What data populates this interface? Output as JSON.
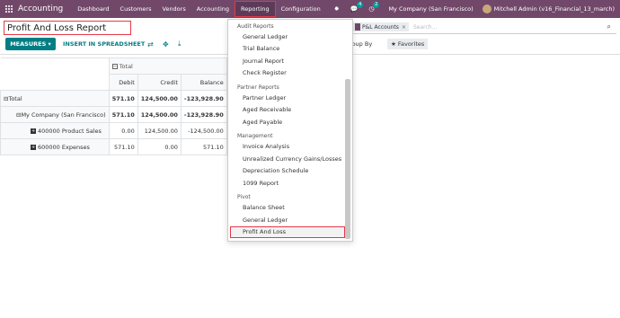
{
  "navbar": {
    "app_name": "Accounting",
    "menu": [
      "Dashboard",
      "Customers",
      "Vendors",
      "Accounting",
      "Reporting",
      "Configuration"
    ],
    "messages_badge": "4",
    "activity_badge": "2",
    "company": "My Company (San Francisco)",
    "user": "Mitchell Admin (v16_Financial_13_march)"
  },
  "control_panel": {
    "title": "Profit And Loss Report",
    "measures_label": "MEASURES",
    "insert_label": "INSERT IN SPREADSHEET",
    "search_facet": "P&L Accounts",
    "search_placeholder": "Search...",
    "group_by_label": "Group By",
    "favorites_label": "Favorites"
  },
  "pivot": {
    "col_group": "Total",
    "measures": [
      "Debit",
      "Credit",
      "Balance"
    ],
    "rows": [
      {
        "label": "Total",
        "debit": "571.10",
        "credit": "124,500.00",
        "balance": "-123,928.90"
      },
      {
        "label": "My Company (San Francisco)",
        "debit": "571.10",
        "credit": "124,500.00",
        "balance": "-123,928.90"
      },
      {
        "label": "400000 Product Sales",
        "debit": "0.00",
        "credit": "124,500.00",
        "balance": "-124,500.00"
      },
      {
        "label": "600000 Expenses",
        "debit": "571.10",
        "credit": "0.00",
        "balance": "571.10"
      }
    ]
  },
  "dropdown": {
    "sections": [
      {
        "header": "Audit Reports",
        "items": [
          "General Ledger",
          "Trial Balance",
          "Journal Report",
          "Check Register"
        ]
      },
      {
        "header": "Partner Reports",
        "items": [
          "Partner Ledger",
          "Aged Receivable",
          "Aged Payable"
        ]
      },
      {
        "header": "Management",
        "items": [
          "Invoice Analysis",
          "Unrealized Currency Gains/Losses",
          "Depreciation Schedule",
          "1099 Report"
        ]
      },
      {
        "header": "Pivot",
        "items": [
          "Balance Sheet",
          "General Ledger",
          "Profit And Loss"
        ]
      }
    ]
  },
  "colors": {
    "navbar": "#71486a",
    "primary": "#017e84",
    "highlight": "#e63946"
  }
}
